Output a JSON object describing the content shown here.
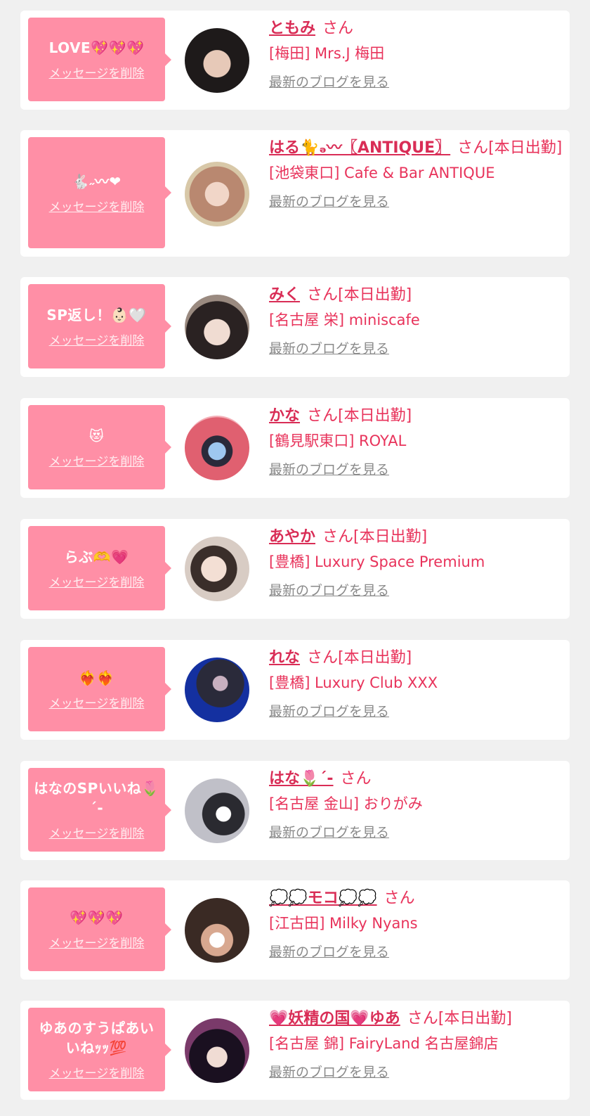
{
  "colors": {
    "bubble": "#ff8fa6",
    "name": "#d92d56",
    "text": "#e8335b",
    "link": "#8a8a8a",
    "background": "#f0f0f0"
  },
  "delete_label": "メッセージを削除",
  "blog_label": "最新のブログを見る",
  "items": [
    {
      "message": "LOVE💖💖💖",
      "name": "ともみ",
      "suffix": "さん",
      "status": "",
      "shop": "[梅田] Mrs.J 梅田",
      "avatar": "#2b2222"
    },
    {
      "message": "🐇˶〰︎❤︎",
      "name": "はる🐈ₔ〰︎〖ANTIQUE〗",
      "suffix": "さん",
      "status": "[本日出勤]",
      "shop": "[池袋東口] Cafe & Bar ANTIQUE",
      "avatar": "#b99a85"
    },
    {
      "message": "SP返し！👶🏻🤍",
      "name": "みく",
      "suffix": "さん",
      "status": "[本日出勤]",
      "shop": "[名古屋 栄] miniscafe",
      "avatar": "#5a4a44"
    },
    {
      "message": "😻",
      "name": "かな",
      "suffix": "さん",
      "status": "[本日出勤]",
      "shop": "[鶴見駅東口] ROYAL",
      "avatar": "#d45a66"
    },
    {
      "message": "らぶ🫶💗",
      "name": "あやか",
      "suffix": "さん",
      "status": "[本日出勤]",
      "shop": "[豊橋] Luxury Space Premium",
      "avatar": "#c8b7ad"
    },
    {
      "message": "❤️‍🔥❤️‍🔥",
      "name": "れな",
      "suffix": "さん",
      "status": "[本日出勤]",
      "shop": "[豊橋] Luxury Club XXX",
      "avatar": "#1c2a6a"
    },
    {
      "message": "はなのSPいいね🌷ˊ-",
      "name": "はな🌷ˊ-",
      "suffix": "さん",
      "status": "",
      "shop": "[名古屋 金山] おりがみ",
      "avatar": "#8a8a8f"
    },
    {
      "message": "💖💖💖",
      "name": "💭💭モコ💭💭",
      "suffix": "さん",
      "status": "",
      "shop": "[江古田] Milky Nyans",
      "avatar": "#4a3a32"
    },
    {
      "message": "ゆあのすうぱあいいねｯｯ💯",
      "name": "💗妖精の国💗ゆあ",
      "suffix": "さん",
      "status": "[本日出勤]",
      "shop": "[名古屋 錦] FairyLand 名古屋錦店",
      "avatar": "#2a1830"
    }
  ]
}
